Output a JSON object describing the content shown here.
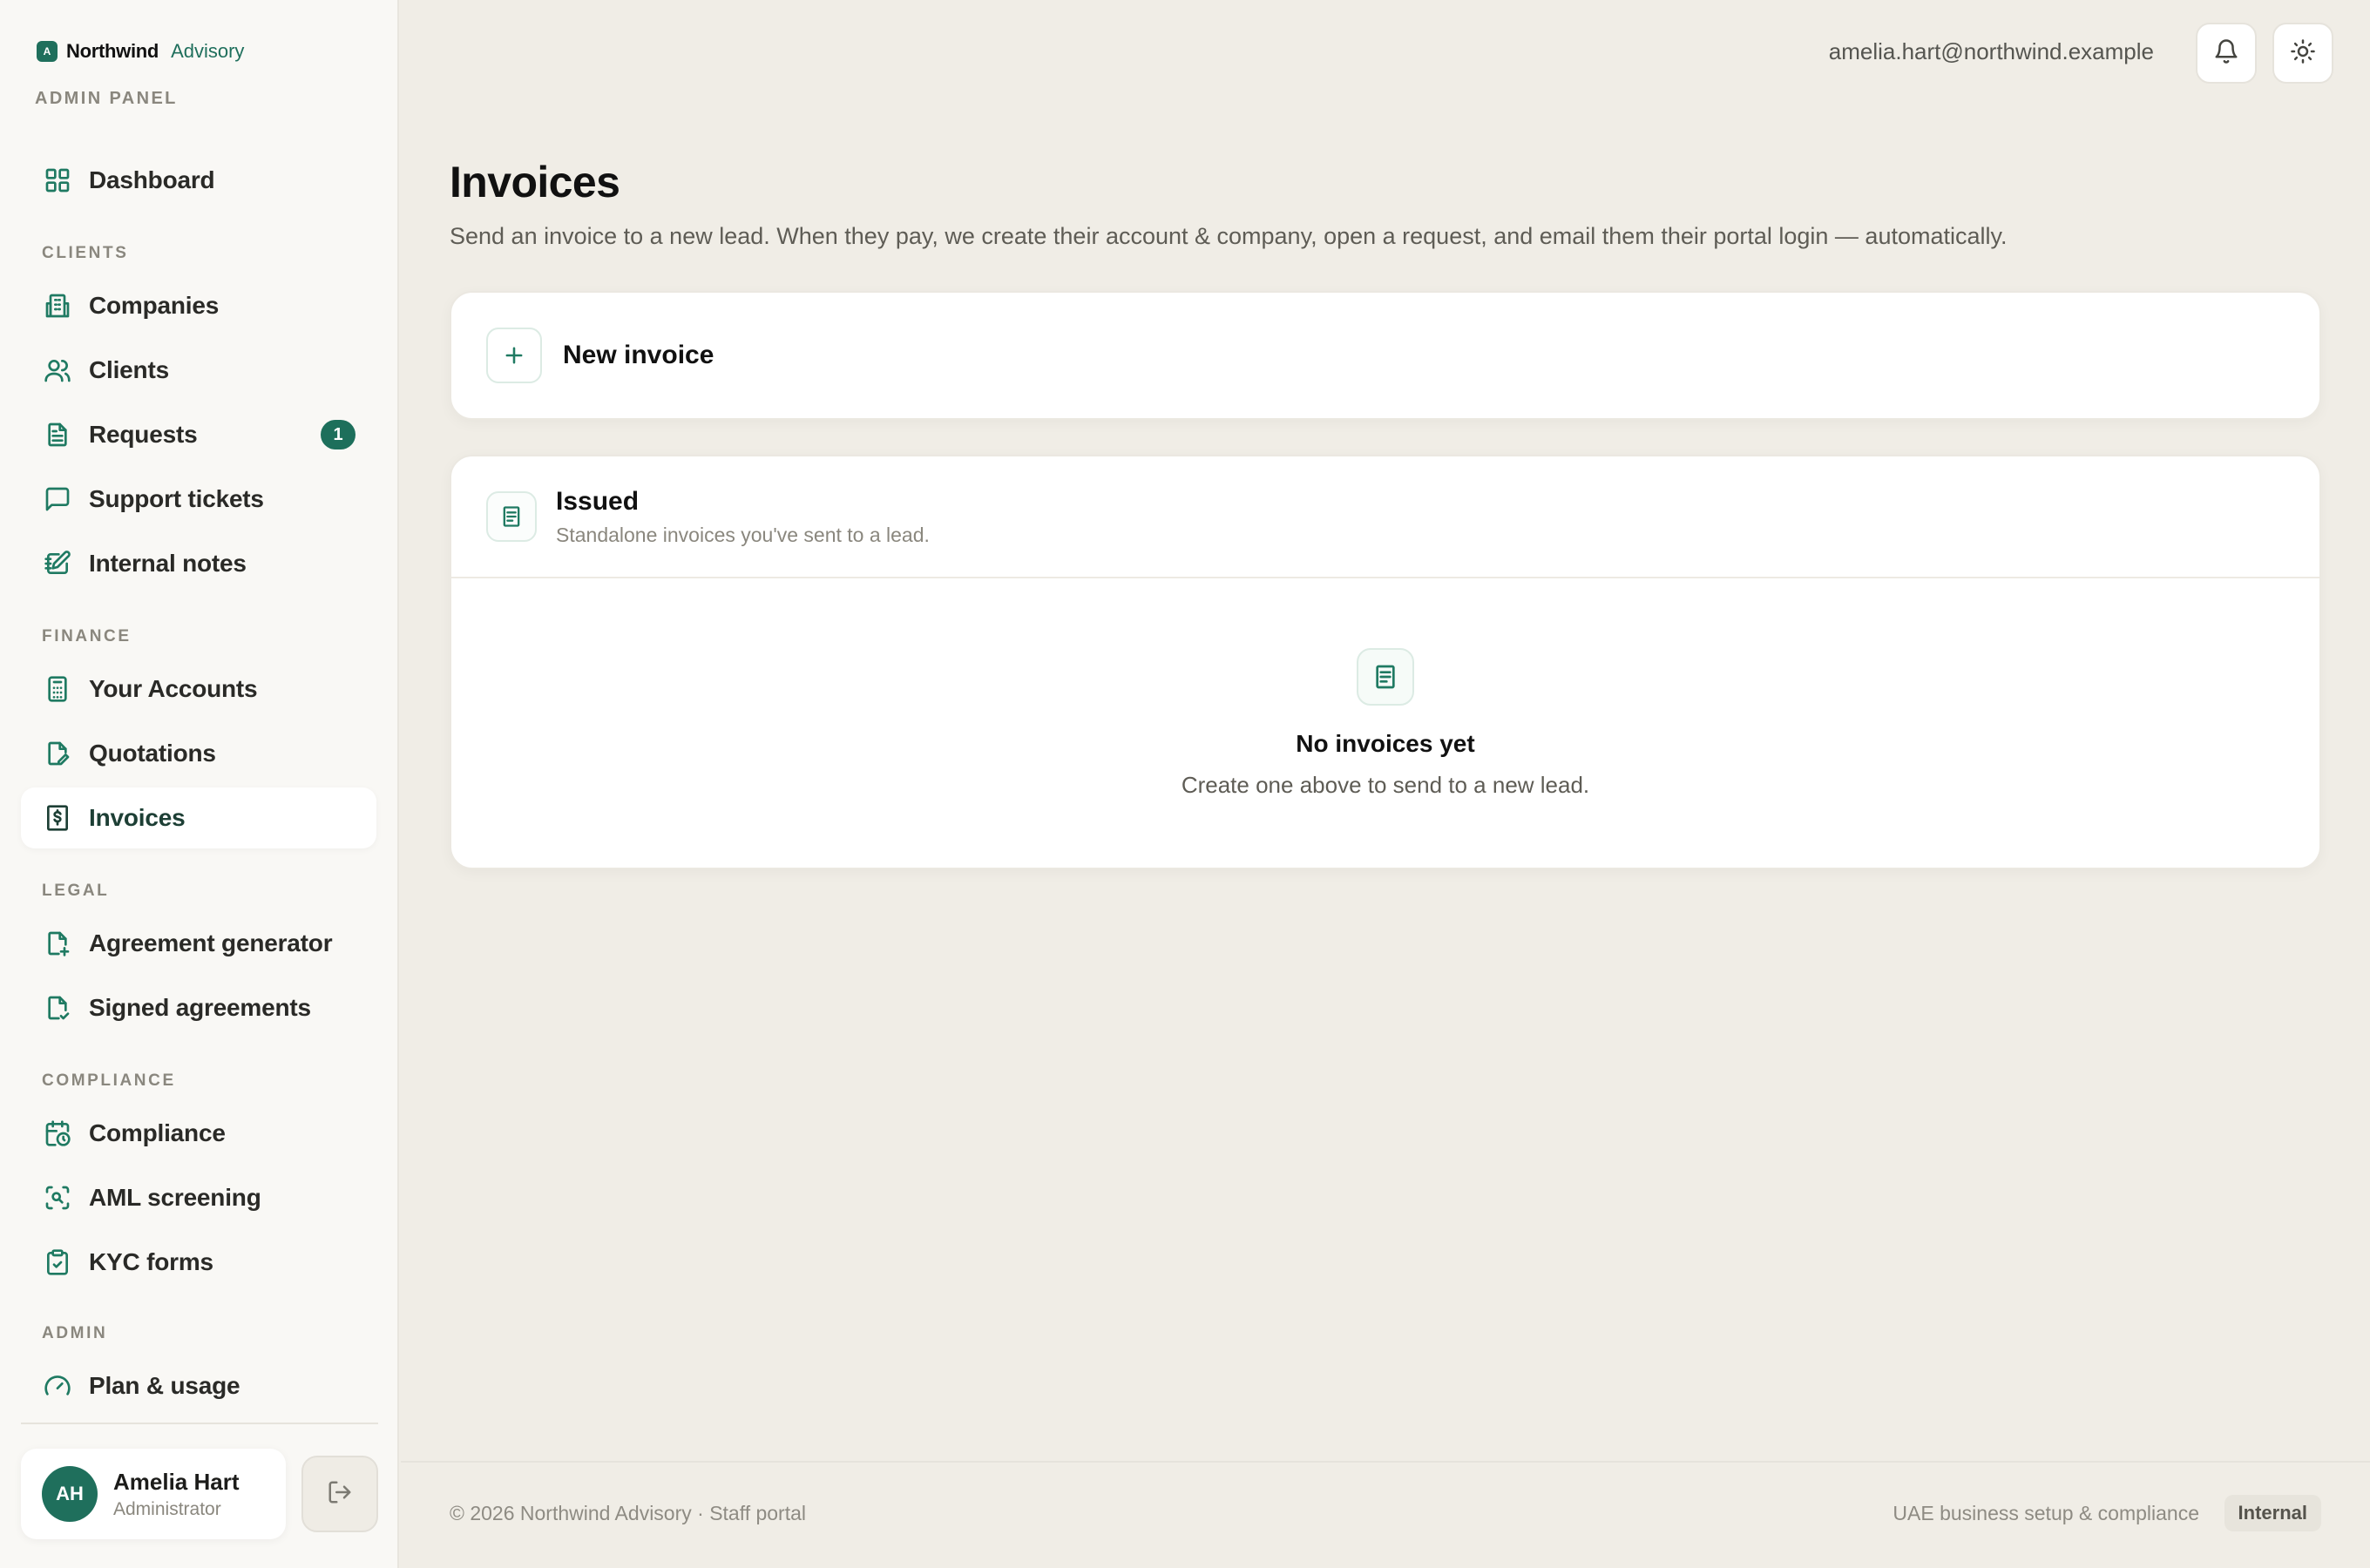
{
  "brand": {
    "mark": "A",
    "name": "Northwind",
    "sub": "Advisory",
    "panel_label": "ADMIN PANEL"
  },
  "sidebar": {
    "sections": {
      "clients": "CLIENTS",
      "finance": "FINANCE",
      "legal": "LEGAL",
      "compliance": "COMPLIANCE",
      "admin": "ADMIN"
    },
    "items": {
      "dashboard": "Dashboard",
      "companies": "Companies",
      "clients": "Clients",
      "requests": "Requests",
      "requests_badge": "1",
      "support_tickets": "Support tickets",
      "internal_notes": "Internal notes",
      "your_accounts": "Your Accounts",
      "quotations": "Quotations",
      "invoices": "Invoices",
      "agreement_generator": "Agreement generator",
      "signed_agreements": "Signed agreements",
      "compliance": "Compliance",
      "aml_screening": "AML screening",
      "kyc_forms": "KYC forms",
      "plan_usage": "Plan & usage"
    },
    "user": {
      "initials": "AH",
      "name": "Amelia Hart",
      "role": "Administrator"
    }
  },
  "topbar": {
    "email": "amelia.hart@northwind.example",
    "bell_icon": "bell-icon",
    "theme_icon": "sun-icon"
  },
  "main": {
    "title": "Invoices",
    "description": "Send an invoice to a new lead. When they pay, we create their account & company, open a request, and email them their portal login — automatically.",
    "new_invoice_label": "New invoice",
    "issued": {
      "title": "Issued",
      "subtitle": "Standalone invoices you've sent to a lead.",
      "empty_title": "No invoices yet",
      "empty_subtitle": "Create one above to send to a new lead."
    }
  },
  "footer": {
    "left": "© 2026 Northwind Advisory · Staff portal",
    "right": "UAE business setup & compliance",
    "pill": "Internal"
  },
  "colors": {
    "accent": "#1f6f5c",
    "background": "#f0ede6",
    "sidebar": "#f9f8f5"
  }
}
